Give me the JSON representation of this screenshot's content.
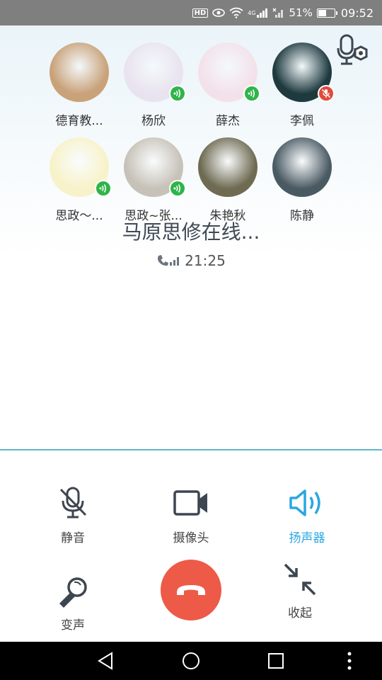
{
  "status_bar": {
    "hd": "HD",
    "signal_tag": "4G",
    "battery_percent_text": "51%",
    "battery_level": 0.51,
    "time": "09:52"
  },
  "members": [
    {
      "name": "德育教...",
      "status": "none",
      "avatar_color": "#c9a27a"
    },
    {
      "name": "杨欣",
      "status": "speaking",
      "avatar_color": "#e9e3ef"
    },
    {
      "name": "薛杰",
      "status": "speaking",
      "avatar_color": "#f3e1ea"
    },
    {
      "name": "李佩",
      "status": "muted",
      "avatar_color": "#1e3a3f"
    },
    {
      "name": "思政～...",
      "status": "speaking",
      "avatar_color": "#f7f2c9"
    },
    {
      "name": "思政~张...",
      "status": "speaking",
      "avatar_color": "#c7c2b8"
    },
    {
      "name": "朱艳秋",
      "status": "none",
      "avatar_color": "#6e6b52"
    },
    {
      "name": "陈静",
      "status": "none",
      "avatar_color": "#4a5a63"
    }
  ],
  "call": {
    "title": "马原思修在线...",
    "timer": "21:25"
  },
  "controls": {
    "mute_label": "静音",
    "camera_label": "摄像头",
    "speaker_label": "扬声器",
    "voice_change_label": "变声",
    "minimize_label": "收起"
  },
  "colors": {
    "accent": "#2aa7e0",
    "hangup": "#ee5a48",
    "speaking_badge": "#2fb44a",
    "muted_badge": "#e24a3b",
    "divider": "#5fb8c7"
  },
  "icons": [
    "hd-icon",
    "eye-icon",
    "wifi-icon",
    "signal-icon",
    "battery-icon",
    "device-mic-icon",
    "phone-signal-icon",
    "mic-off-icon",
    "camera-icon",
    "speaker-icon",
    "voice-change-icon",
    "hangup-icon",
    "collapse-icon",
    "nav-back-icon",
    "nav-home-icon",
    "nav-recent-icon",
    "nav-more-icon"
  ]
}
